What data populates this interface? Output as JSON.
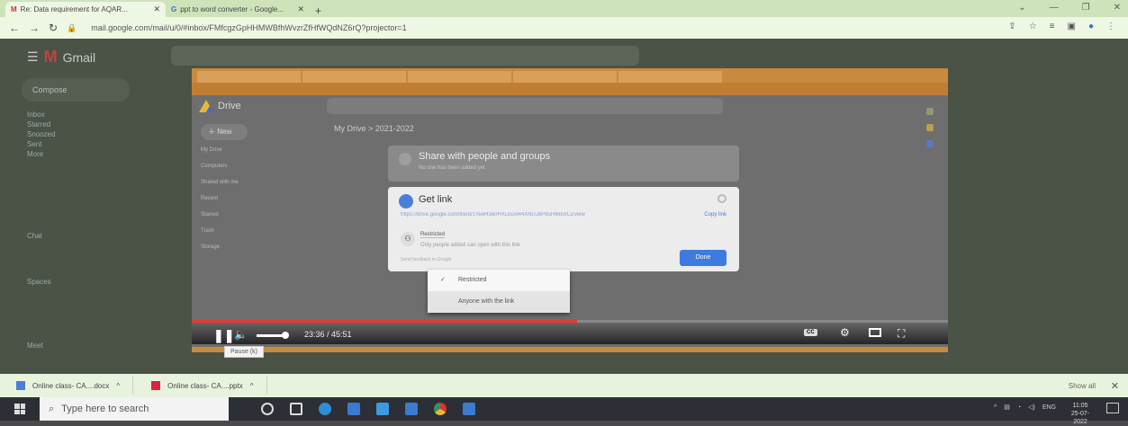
{
  "browser": {
    "tabs": [
      {
        "label": "Re: Data requirement for AQAR...",
        "active": true
      },
      {
        "label": "ppt to word converter - Google...",
        "active": false
      }
    ],
    "url": "mail.google.com/mail/u/0/#inbox/FMfcgzGpHHMWBfhWvzrZfHfWQdNZ6rQ?projector=1"
  },
  "gmail": {
    "app_name": "Gmail",
    "compose_label": "Compose",
    "side_items": [
      "Inbox",
      "Starred",
      "Snoozed",
      "Sent",
      "More",
      "Chat",
      "Spaces",
      "Meet"
    ]
  },
  "drive": {
    "app_name": "Drive",
    "new_label": "New",
    "breadcrumb": "My Drive  >  2021-2022",
    "side_items": [
      "My Drive",
      "Computers",
      "Shared with me",
      "Recent",
      "Starred",
      "Trash",
      "Storage"
    ],
    "share_dialog": {
      "title": "Share with people and groups",
      "subtitle": "No one has been added yet"
    },
    "get_link": {
      "title": "Get link",
      "url": "https://drive.google.com/file/d/1YeeH3e0HXLbcAR4XNUJ8P8uHfkBvrLz/view",
      "copy_label": "Copy link",
      "access_select": "Restricted",
      "description": "Only people added can open with this link",
      "feedback": "Send feedback to Google",
      "done_label": "Done"
    },
    "access_menu": [
      {
        "label": "Restricted",
        "checked": true
      },
      {
        "label": "Anyone with the link",
        "checked": false
      }
    ]
  },
  "video": {
    "time": "23:36 / 45:51",
    "progress_fraction": 0.51,
    "tooltip": "Pause (k)",
    "cc_label": "CC"
  },
  "downloads": {
    "items": [
      "Online class- CA....docx",
      "Online class- CA....pptx"
    ],
    "show_all": "Show all"
  },
  "taskbar": {
    "search_placeholder": "Type here to search",
    "lang": "ENG",
    "time": "11:05",
    "date": "25-07-2022"
  }
}
